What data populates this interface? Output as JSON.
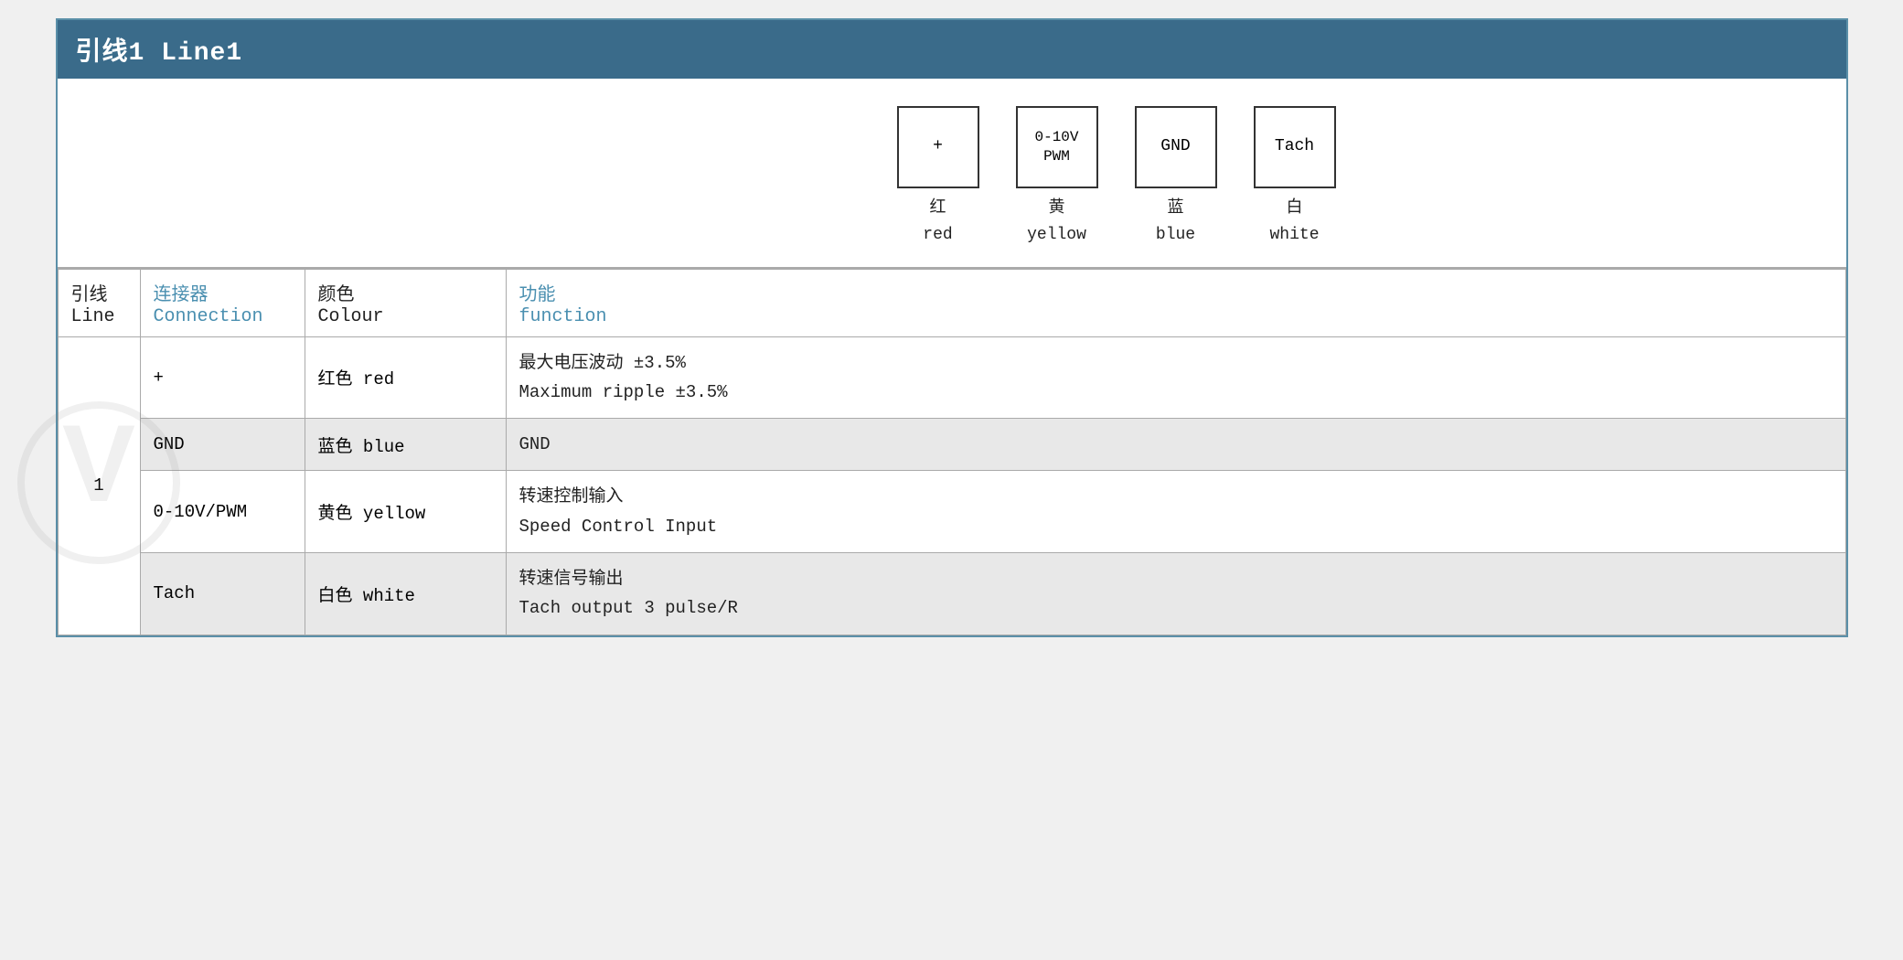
{
  "title": "引线1 Line1",
  "diagram": {
    "connectors": [
      {
        "id": "plus",
        "symbol": "+",
        "chinese_label": "红",
        "english_label": "red"
      },
      {
        "id": "pwm",
        "symbol": "0-10V\nPWM",
        "chinese_label": "黄",
        "english_label": "yellow"
      },
      {
        "id": "gnd",
        "symbol": "GND",
        "chinese_label": "蓝",
        "english_label": "blue"
      },
      {
        "id": "tach",
        "symbol": "Tach",
        "chinese_label": "白",
        "english_label": "white"
      }
    ]
  },
  "table": {
    "headers": {
      "line_zh": "引线",
      "line_en": "Line",
      "conn_zh": "连接器",
      "conn_en": "Connection",
      "color_zh": "颜色",
      "color_en": "Colour",
      "func_zh": "功能",
      "func_en": "function"
    },
    "rows": [
      {
        "line": "1",
        "rowspan": 4,
        "connection": "+",
        "color_zh": "红色",
        "color_en": "red",
        "func_zh": "最大电压波动 ±3.5%",
        "func_en": "Maximum ripple ±3.5%",
        "alt": false
      },
      {
        "connection": "GND",
        "color_zh": "蓝色",
        "color_en": "blue",
        "func_zh": "GND",
        "func_en": "",
        "alt": true
      },
      {
        "connection": "0-10V/PWM",
        "color_zh": "黄色",
        "color_en": "yellow",
        "func_zh": "转速控制输入",
        "func_en": "Speed Control Input",
        "alt": false
      },
      {
        "connection": "Tach",
        "color_zh": "白色",
        "color_en": "white",
        "func_zh": "转速信号输出",
        "func_en": "Tach output 3 pulse/R",
        "alt": true
      }
    ]
  }
}
